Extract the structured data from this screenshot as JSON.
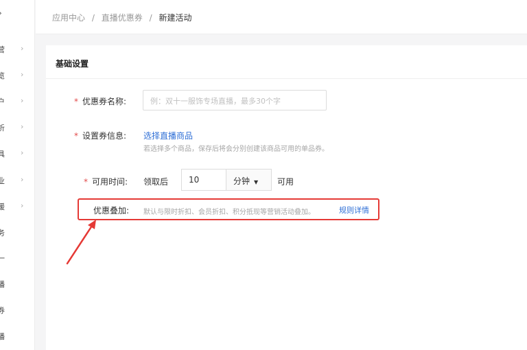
{
  "sidebar": {
    "top_glyph": "›",
    "items": [
      {
        "label": "营",
        "has_chevron": true
      },
      {
        "label": "览",
        "has_chevron": true
      },
      {
        "label": "户",
        "has_chevron": true
      },
      {
        "label": "析",
        "has_chevron": true
      },
      {
        "label": "具",
        "has_chevron": true
      },
      {
        "label": "业",
        "has_chevron": true
      },
      {
        "label": "援",
        "has_chevron": true
      },
      {
        "label": "务",
        "has_chevron": false
      },
      {
        "label": "一",
        "has_chevron": false
      },
      {
        "label": "播",
        "has_chevron": false
      },
      {
        "label": "券",
        "has_chevron": false
      },
      {
        "label": "播",
        "has_chevron": false
      }
    ]
  },
  "breadcrumb": {
    "items": [
      "应用中心",
      "/",
      "直播优惠券",
      "/",
      "新建活动"
    ]
  },
  "panel": {
    "title": "基础设置"
  },
  "form": {
    "name_label": "优惠券名称:",
    "name_placeholder": "例：双十一服饰专场直播，最多30个字",
    "info_label": "设置券信息:",
    "info_link": "选择直播商品",
    "info_hint": "若选择多个商品，保存后将会分别创建该商品可用的单品券。",
    "time_label": "可用时间:",
    "time_prefix": "领取后",
    "time_value": "10",
    "time_unit": "分钟",
    "time_suffix": "可用",
    "stack_label": "优惠叠加:",
    "stack_hint": "默认与限时折扣、会员折扣、积分抵现等营销活动叠加。",
    "stack_link": "规则详情",
    "required_mark": "*"
  },
  "colors": {
    "highlight_box": "#e53935",
    "link": "#2f6fd6",
    "required": "#e24c4c"
  }
}
